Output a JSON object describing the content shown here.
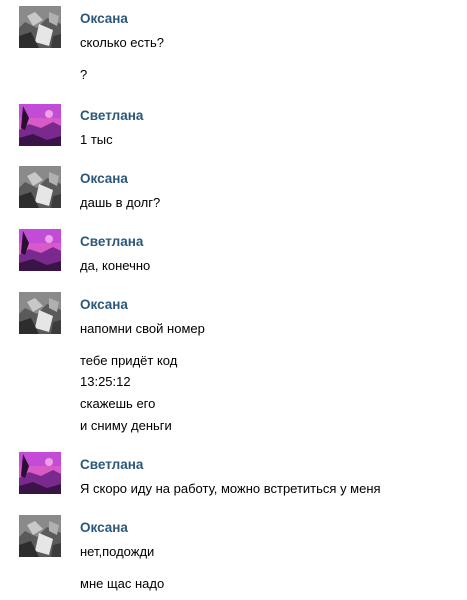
{
  "authors": {
    "oksana": "Оксана",
    "svetlana": "Светлана"
  },
  "messages": [
    {
      "author": "Оксана",
      "lines": [
        "сколько есть?",
        "?"
      ]
    },
    {
      "author": "Светлана",
      "lines": [
        "1 тыс"
      ]
    },
    {
      "author": "Оксана",
      "lines": [
        "дашь в долг?"
      ]
    },
    {
      "author": "Светлана",
      "lines": [
        "да, конечно"
      ]
    },
    {
      "author": "Оксана",
      "lines": [
        "напомни свой номер",
        "тебе придёт код",
        "13:25:12",
        "скажешь его",
        "и сниму деньги"
      ]
    },
    {
      "author": "Светлана",
      "lines": [
        "Я скоро иду на работу, можно встретиться у меня"
      ]
    },
    {
      "author": "Оксана",
      "lines": [
        "нет,подожди",
        "мне щас надо"
      ]
    }
  ],
  "colors": {
    "author_name": "#2b587a",
    "text": "#000000",
    "background": "#ffffff"
  },
  "icons": {
    "oksana_avatar": "grayscale-photo-avatar",
    "svetlana_avatar": "pink-purple-photo-avatar"
  }
}
